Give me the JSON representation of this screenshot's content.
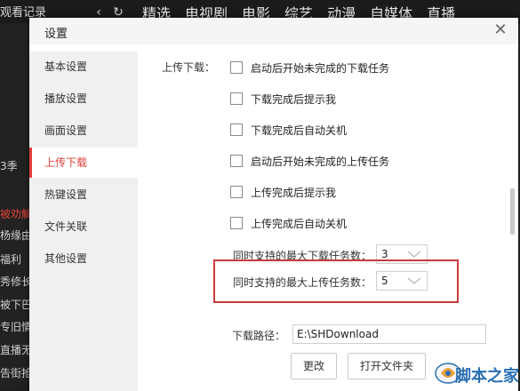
{
  "background": {
    "history_label": "观看记录",
    "nav_tabs": [
      "精选",
      "电视剧",
      "电影",
      "综艺",
      "动漫",
      "自媒体",
      "直播"
    ],
    "left_items": [
      {
        "text": "3季",
        "highlight": false
      },
      {
        "text": "被劝解",
        "highlight": true
      },
      {
        "text": "杨缘由",
        "highlight": false
      },
      {
        "text": "福利",
        "highlight": false
      },
      {
        "text": "秀修长",
        "highlight": false
      },
      {
        "text": "被下巴",
        "highlight": false
      },
      {
        "text": "专旧情",
        "highlight": false
      },
      {
        "text": "直播无",
        "highlight": false
      },
      {
        "text": "告街抢",
        "highlight": false
      }
    ]
  },
  "dialog": {
    "title": "设置",
    "close_glyph": "✕",
    "sidebar": {
      "items": [
        {
          "label": "基本设置",
          "active": false
        },
        {
          "label": "播放设置",
          "active": false
        },
        {
          "label": "画面设置",
          "active": false
        },
        {
          "label": "上传下载",
          "active": true
        },
        {
          "label": "热键设置",
          "active": false
        },
        {
          "label": "文件关联",
          "active": false
        },
        {
          "label": "其他设置",
          "active": false
        }
      ]
    },
    "upload_download": {
      "section_label": "上传下载：",
      "options": [
        {
          "label": "启动后开始未完成的下载任务",
          "checked": false
        },
        {
          "label": "下载完成后提示我",
          "checked": false
        },
        {
          "label": "下载完成后自动关机",
          "checked": false
        },
        {
          "label": "启动后开始未完成的上传任务",
          "checked": false
        },
        {
          "label": "上传完成后提示我",
          "checked": false
        },
        {
          "label": "上传完成后自动关机",
          "checked": false
        }
      ],
      "max_download_label": "同时支持的最大下载任务数：",
      "max_download_value": "3",
      "max_upload_label": "同时支持的最大上传任务数：",
      "max_upload_value": "5",
      "path_label": "下载路径：",
      "path_value": "E:\\SHDownload",
      "change_button": "更改",
      "open_folder_button": "打开文件夹"
    }
  },
  "watermark": {
    "text": "脚本之家"
  },
  "colors": {
    "accent": "#e0403a",
    "highlight_box": "#cc3b3b"
  }
}
